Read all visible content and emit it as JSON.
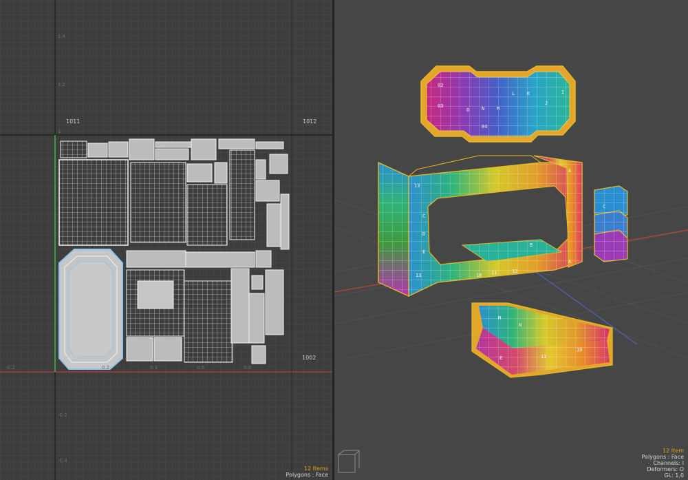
{
  "uv_editor": {
    "tiles": {
      "t1011": "1011",
      "t1012": "1012",
      "t1001": "1001",
      "t1002": "1002"
    },
    "ticks": {
      "v14": "1.4",
      "v12": "1.2",
      "v1": "1",
      "vm02": "-0.2",
      "vm04": "-0.4",
      "um02": "-0.2",
      "u02": "0.2",
      "u04": "0.4",
      "u06": "0.6",
      "u08": "0.8"
    },
    "status": {
      "items": "12 Items",
      "mode": "Polygons : Face"
    }
  },
  "viewport": {
    "status": {
      "items": "12 Item",
      "mode": "Polygons : Face",
      "channels": "Channels: I",
      "deformers": "Deformers: O",
      "gl": "GL: 1,0"
    },
    "checker_labels": [
      "02",
      "03",
      "04",
      "13",
      "12",
      "11",
      "10",
      "A",
      "B",
      "C",
      "D",
      "E",
      "I",
      "J",
      "K",
      "L",
      "M",
      "N",
      "O"
    ]
  },
  "colors": {
    "grid_bg": "#3d3d3d",
    "viewport_bg": "#464646",
    "selection": "#e8b923",
    "uv_fill": "#b9b9b9",
    "uv_edge": "#f2f2f2",
    "selected_uv": "#8ec6ea",
    "axis_red": "#b83a3a",
    "axis_green": "#3bb24a"
  }
}
